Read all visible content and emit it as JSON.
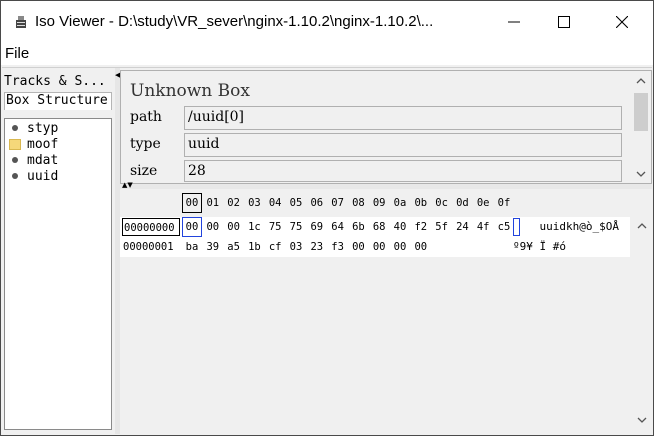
{
  "window": {
    "title": "Iso Viewer - D:\\study\\VR_sever\\nginx-1.10.2\\nginx-1.10.2\\..."
  },
  "menu": [
    "File"
  ],
  "left_panel": {
    "tabs": [
      "Tracks & S...",
      "Box Structure"
    ],
    "tree": [
      {
        "label": "styp",
        "icon": "leaf-dot-icon"
      },
      {
        "label": "moof",
        "icon": "folder-icon"
      },
      {
        "label": "mdat",
        "icon": "leaf-dot-icon"
      },
      {
        "label": "uuid",
        "icon": "leaf-dot-icon"
      }
    ]
  },
  "details": {
    "title": "Unknown Box",
    "fields": [
      {
        "label": "path",
        "value": "/uuid[0]"
      },
      {
        "label": "type",
        "value": "uuid"
      },
      {
        "label": "size",
        "value": "28"
      }
    ]
  },
  "hex": {
    "header": [
      "00",
      "01",
      "02",
      "03",
      "04",
      "05",
      "06",
      "07",
      "08",
      "09",
      "0a",
      "0b",
      "0c",
      "0d",
      "0e",
      "0f"
    ],
    "rows": [
      {
        "offset": "00000000",
        "bytes": [
          "00",
          "00",
          "00",
          "1c",
          "75",
          "75",
          "69",
          "64",
          "6b",
          "68",
          "40",
          "f2",
          "5f",
          "24",
          "4f",
          "c5"
        ],
        "ascii": "    uuidkh@ò_$OÅ"
      },
      {
        "offset": "00000001",
        "bytes": [
          "ba",
          "39",
          "a5",
          "1b",
          "cf",
          "03",
          "23",
          "f3",
          "00",
          "00",
          "00",
          "00"
        ],
        "ascii": "º9¥ Ï #ó"
      }
    ]
  },
  "colors": {
    "selection_blue": "#2244dd",
    "folder": "#f5d87a"
  }
}
